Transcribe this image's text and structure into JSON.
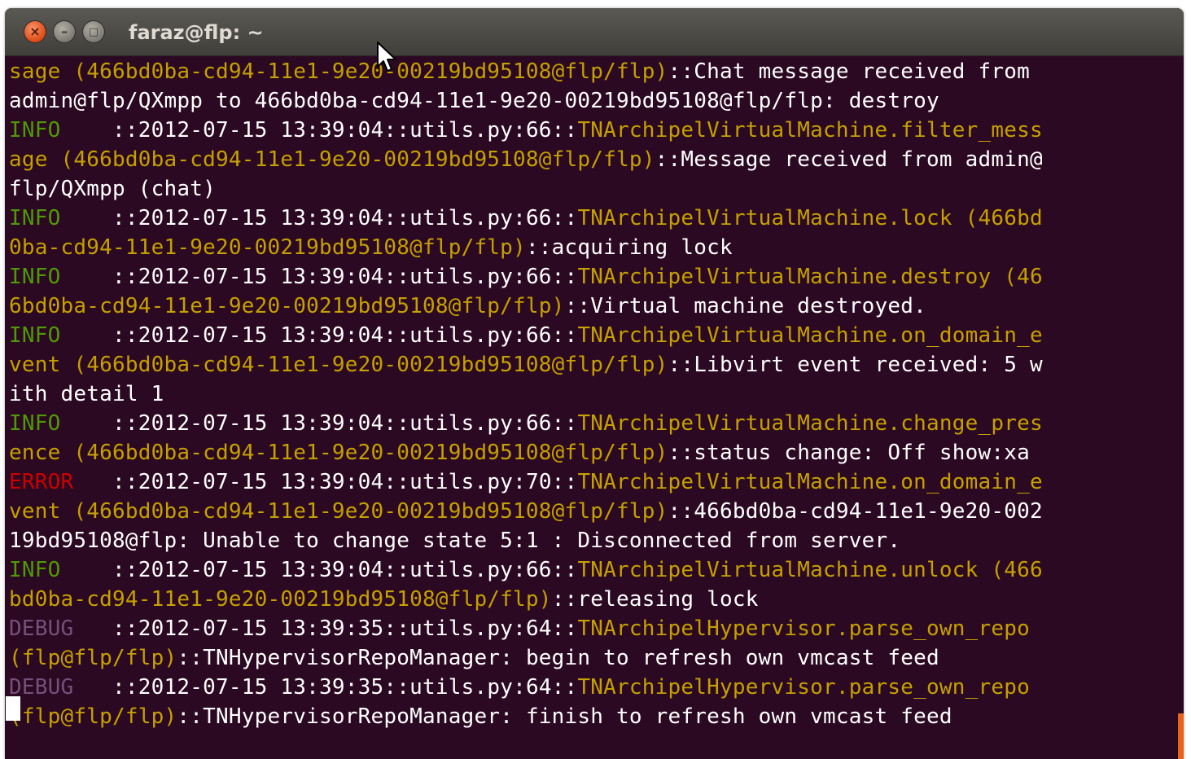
{
  "window": {
    "title": "faraz@flp: ~",
    "buttons": {
      "close": "×",
      "minimize": "–",
      "maximize": "□"
    }
  },
  "colors": {
    "terminal_bg": "#2c0922",
    "info": "#4e9a06",
    "error": "#cc0000",
    "debug": "#75507b",
    "class_name": "#c4a000",
    "text": "#ffffff"
  },
  "terminal": {
    "lines": [
      [
        {
          "t": "sage (466bd0ba-cd94-11e1-9e20-00219bd95108@flp/flp)",
          "c": "cls"
        },
        {
          "t": "::Chat message received from",
          "c": ""
        }
      ],
      [
        {
          "t": "admin@flp/QXmpp to 466bd0ba-cd94-11e1-9e20-00219bd95108@flp/flp: destroy",
          "c": ""
        }
      ],
      [
        {
          "t": "INFO",
          "c": "lvl-info"
        },
        {
          "t": "    ::2012-07-15 13:39:04::utils.py:66::",
          "c": ""
        },
        {
          "t": "TNArchipelVirtualMachine.filter_mess",
          "c": "cls"
        }
      ],
      [
        {
          "t": "age (466bd0ba-cd94-11e1-9e20-00219bd95108@flp/flp)",
          "c": "cls"
        },
        {
          "t": "::Message received from admin@",
          "c": ""
        }
      ],
      [
        {
          "t": "flp/QXmpp (chat)",
          "c": ""
        }
      ],
      [
        {
          "t": "INFO",
          "c": "lvl-info"
        },
        {
          "t": "    ::2012-07-15 13:39:04::utils.py:66::",
          "c": ""
        },
        {
          "t": "TNArchipelVirtualMachine.lock (466bd",
          "c": "cls"
        }
      ],
      [
        {
          "t": "0ba-cd94-11e1-9e20-00219bd95108@flp/flp)",
          "c": "cls"
        },
        {
          "t": "::acquiring lock",
          "c": ""
        }
      ],
      [
        {
          "t": "INFO",
          "c": "lvl-info"
        },
        {
          "t": "    ::2012-07-15 13:39:04::utils.py:66::",
          "c": ""
        },
        {
          "t": "TNArchipelVirtualMachine.destroy (46",
          "c": "cls"
        }
      ],
      [
        {
          "t": "6bd0ba-cd94-11e1-9e20-00219bd95108@flp/flp)",
          "c": "cls"
        },
        {
          "t": "::Virtual machine destroyed.",
          "c": ""
        }
      ],
      [
        {
          "t": "INFO",
          "c": "lvl-info"
        },
        {
          "t": "    ::2012-07-15 13:39:04::utils.py:66::",
          "c": ""
        },
        {
          "t": "TNArchipelVirtualMachine.on_domain_e",
          "c": "cls"
        }
      ],
      [
        {
          "t": "vent (466bd0ba-cd94-11e1-9e20-00219bd95108@flp/flp)",
          "c": "cls"
        },
        {
          "t": "::Libvirt event received: 5 w",
          "c": ""
        }
      ],
      [
        {
          "t": "ith detail 1",
          "c": ""
        }
      ],
      [
        {
          "t": "INFO",
          "c": "lvl-info"
        },
        {
          "t": "    ::2012-07-15 13:39:04::utils.py:66::",
          "c": ""
        },
        {
          "t": "TNArchipelVirtualMachine.change_pres",
          "c": "cls"
        }
      ],
      [
        {
          "t": "ence (466bd0ba-cd94-11e1-9e20-00219bd95108@flp/flp)",
          "c": "cls"
        },
        {
          "t": "::status change: Off show:xa",
          "c": ""
        }
      ],
      [
        {
          "t": "ERROR",
          "c": "lvl-error"
        },
        {
          "t": "   ::2012-07-15 13:39:04::utils.py:70::",
          "c": ""
        },
        {
          "t": "TNArchipelVirtualMachine.on_domain_e",
          "c": "cls"
        }
      ],
      [
        {
          "t": "vent (466bd0ba-cd94-11e1-9e20-00219bd95108@flp/flp)",
          "c": "cls"
        },
        {
          "t": "::466bd0ba-cd94-11e1-9e20-002",
          "c": ""
        }
      ],
      [
        {
          "t": "19bd95108@flp: Unable to change state 5:1 : Disconnected from server.",
          "c": ""
        }
      ],
      [
        {
          "t": "INFO",
          "c": "lvl-info"
        },
        {
          "t": "    ::2012-07-15 13:39:04::utils.py:66::",
          "c": ""
        },
        {
          "t": "TNArchipelVirtualMachine.unlock (466",
          "c": "cls"
        }
      ],
      [
        {
          "t": "bd0ba-cd94-11e1-9e20-00219bd95108@flp/flp)",
          "c": "cls"
        },
        {
          "t": "::releasing lock",
          "c": ""
        }
      ],
      [
        {
          "t": "DEBUG",
          "c": "lvl-debug"
        },
        {
          "t": "   ::2012-07-15 13:39:35::utils.py:64::",
          "c": ""
        },
        {
          "t": "TNArchipelHypervisor.parse_own_repo",
          "c": "cls"
        }
      ],
      [
        {
          "t": "(flp@flp/flp)",
          "c": "cls"
        },
        {
          "t": "::TNHypervisorRepoManager: begin to refresh own vmcast feed",
          "c": ""
        }
      ],
      [
        {
          "t": "DEBUG",
          "c": "lvl-debug"
        },
        {
          "t": "   ::2012-07-15 13:39:35::utils.py:64::",
          "c": ""
        },
        {
          "t": "TNArchipelHypervisor.parse_own_repo",
          "c": "cls"
        }
      ],
      [
        {
          "t": "(flp@flp/flp)",
          "c": "cls"
        },
        {
          "t": "::TNHypervisorRepoManager: finish to refresh own vmcast feed",
          "c": ""
        }
      ]
    ]
  }
}
